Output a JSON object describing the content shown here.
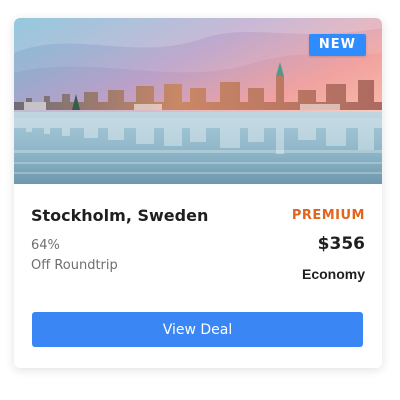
{
  "card": {
    "badge": "NEW",
    "destination": "Stockholm, Sweden",
    "discount_percent": "64%",
    "discount_label": "Off Roundtrip",
    "tier": "PREMIUM",
    "price": "$356",
    "cabin": "Economy",
    "cta_label": "View Deal"
  },
  "colors": {
    "badge_bg": "#2f8cff",
    "tier_text": "#e3641c",
    "cta_bg": "#3a86f5"
  },
  "image": {
    "subject": "Stockholm waterfront skyline at sunset with reflections"
  }
}
